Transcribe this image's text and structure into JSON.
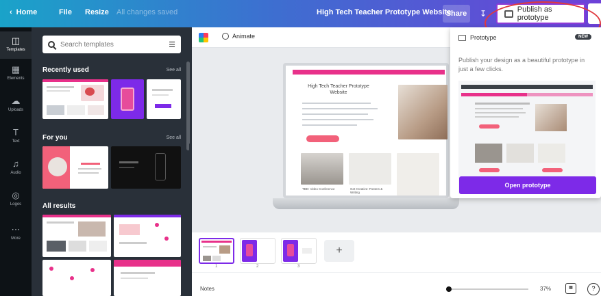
{
  "topbar": {
    "home": "Home",
    "file": "File",
    "resize": "Resize",
    "saved_status": "All changes saved",
    "title": "High Tech Teacher Prototype Website",
    "share": "Share",
    "download_icon": "download-icon",
    "publish": "Publish as prototype",
    "gradient_start": "#1aa3c9",
    "gradient_end": "#6d40d8"
  },
  "rail": {
    "items": [
      {
        "label": "Templates",
        "icon": "template-icon"
      },
      {
        "label": "Elements",
        "icon": "elements-icon"
      },
      {
        "label": "Uploads",
        "icon": "upload-icon"
      },
      {
        "label": "Text",
        "icon": "text-icon"
      },
      {
        "label": "Audio",
        "icon": "audio-icon"
      },
      {
        "label": "Logos",
        "icon": "logo-icon"
      },
      {
        "label": "More",
        "icon": "more-icon"
      }
    ]
  },
  "panel": {
    "search_placeholder": "Search templates",
    "sections": [
      {
        "title": "Recently used",
        "see_all": "See all"
      },
      {
        "title": "For you",
        "see_all": "See all"
      },
      {
        "title": "All results",
        "see_all": ""
      }
    ]
  },
  "canvas": {
    "animate": "Animate",
    "mock_title": "High Tech Teacher Prototype Website",
    "mock_captions": [
      "TBD: Video Conference",
      "Get Creative: Posters & Writing"
    ]
  },
  "popover": {
    "heading": "Prototype",
    "badge": "NEW",
    "description": "Publish your design as a beautiful prototype in just a few clicks.",
    "open_button": "Open prototype",
    "accent_color": "#7d2ae8"
  },
  "pages": {
    "numbers": [
      "1",
      "2",
      "3"
    ],
    "add": "+"
  },
  "footer": {
    "notes": "Notes",
    "zoom": "37%",
    "help": "?"
  }
}
